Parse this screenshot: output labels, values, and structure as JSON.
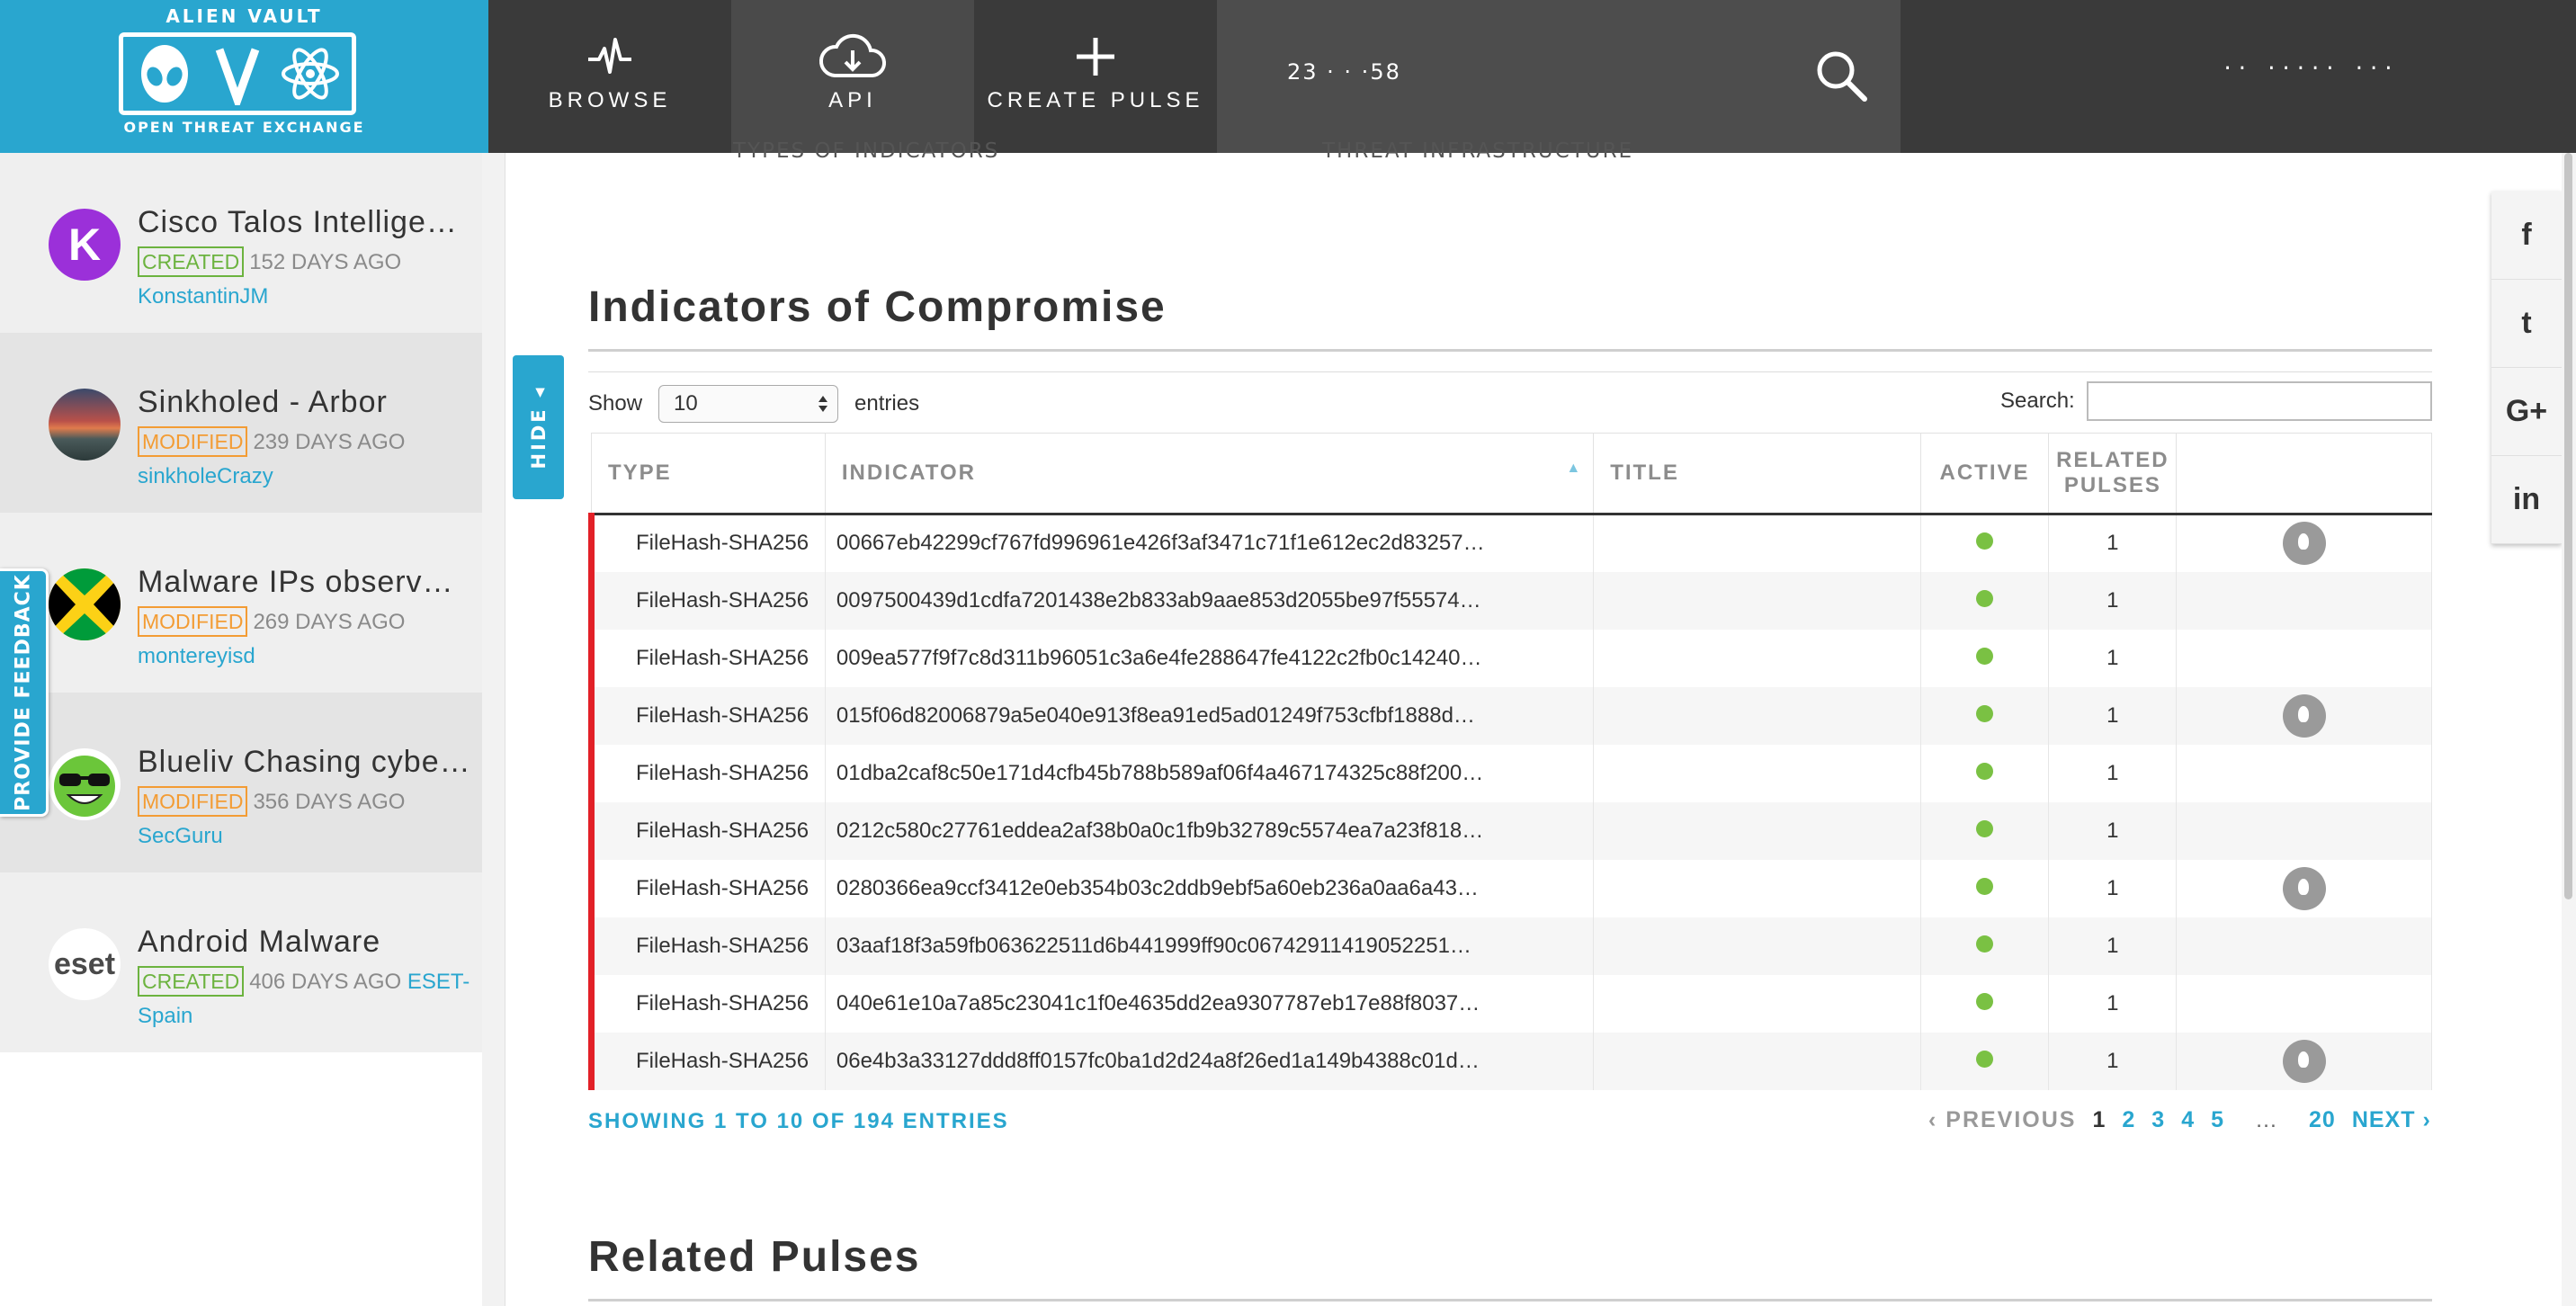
{
  "brand": {
    "top": "ALIEN VAULT",
    "mark": "OTX",
    "bottom": "OPEN THREAT EXCHANGE",
    "color": "#29a6cf"
  },
  "nav": {
    "browse": "BROWSE",
    "api": "API",
    "create": "CREATE PULSE"
  },
  "search": {
    "value": "23 · · ·58"
  },
  "user": {
    "label": "·· ····· ···"
  },
  "hide_tab": "HIDE ◂",
  "feedback": "PROVIDE FEEDBACK",
  "sidebar": {
    "pulses": [
      {
        "title": "Cisco Talos Intelligen…",
        "badge": "CREATED",
        "age": "152 DAYS AGO",
        "author": "KonstantinJM",
        "avatar": "K"
      },
      {
        "title": "Sinkholed - Arbor",
        "badge": "MODIFIED",
        "age": "239 DAYS AGO",
        "author": "sinkholeCrazy"
      },
      {
        "title": "Malware IPs observe…",
        "badge": "MODIFIED",
        "age": "269 DAYS AGO",
        "author": "montereyisd"
      },
      {
        "title": "Blueliv Chasing cyber…",
        "badge": "MODIFIED",
        "age": "356 DAYS AGO",
        "author": "SecGuru"
      },
      {
        "title": "Android Malware",
        "badge": "CREATED",
        "age": "406 DAYS AGO",
        "author_inline": "ESET-",
        "author": "Spain",
        "avatar": "eset"
      }
    ]
  },
  "section_top": {
    "left": "TYPES OF INDICATORS",
    "right": "THREAT INFRASTRUCTURE"
  },
  "ioc": {
    "heading": "Indicators of Compromise",
    "show_label": "Show",
    "show_value": "10",
    "entries_label": "entries",
    "search_label": "Search:",
    "columns": [
      "TYPE",
      "INDICATOR",
      "TITLE",
      "ACTIVE",
      "RELATED",
      "PULSES"
    ],
    "rows": [
      {
        "type": "FileHash-SHA256",
        "indicator": "00667eb42299cf767fd996961e426f3af3471c71f1e612ec2d83257…",
        "related": "1",
        "pulse_btn": true
      },
      {
        "type": "FileHash-SHA256",
        "indicator": "0097500439d1cdfa7201438e2b833ab9aae853d2055be97f55574…",
        "related": "1",
        "pulse_btn": false
      },
      {
        "type": "FileHash-SHA256",
        "indicator": "009ea577f9f7c8d311b96051c3a6e4fe288647fe4122c2fb0c14240…",
        "related": "1",
        "pulse_btn": false
      },
      {
        "type": "FileHash-SHA256",
        "indicator": "015f06d82006879a5e040e913f8ea91ed5ad01249f753cfbf1888d…",
        "related": "1",
        "pulse_btn": true
      },
      {
        "type": "FileHash-SHA256",
        "indicator": "01dba2caf8c50e171d4cfb45b788b589af06f4a467174325c88f200…",
        "related": "1",
        "pulse_btn": false
      },
      {
        "type": "FileHash-SHA256",
        "indicator": "0212c580c27761eddea2af38b0a0c1fb9b32789c5574ea7a23f818…",
        "related": "1",
        "pulse_btn": false
      },
      {
        "type": "FileHash-SHA256",
        "indicator": "0280366ea9ccf3412e0eb354b03c2ddb9ebf5a60eb236a0aa6a43…",
        "related": "1",
        "pulse_btn": true
      },
      {
        "type": "FileHash-SHA256",
        "indicator": "03aaf18f3a59fb063622511d6b441999ff90c06742911419052251…",
        "related": "1",
        "pulse_btn": false
      },
      {
        "type": "FileHash-SHA256",
        "indicator": "040e61e10a7a85c23041c1f0e4635dd2ea9307787eb17e88f8037…",
        "related": "1",
        "pulse_btn": false
      },
      {
        "type": "FileHash-SHA256",
        "indicator": "06e4b3a33127ddd8ff0157fc0ba1d2d24a8f26ed1a149b4388c01d…",
        "related": "1",
        "pulse_btn": true
      }
    ],
    "showing": "SHOWING 1 TO 10 OF 194 ENTRIES",
    "pager": {
      "prev": "‹ PREVIOUS",
      "pages": [
        "1",
        "2",
        "3",
        "4",
        "5"
      ],
      "ellipsis": "…",
      "last": "20",
      "next": "NEXT ›"
    }
  },
  "related": {
    "heading": "Related Pulses"
  },
  "social": [
    "f",
    "t",
    "G+",
    "in"
  ],
  "colors": {
    "active": "#7ac143",
    "created": "#6cb33f",
    "modified": "#f39c34",
    "malicious_bar": "#e22027"
  }
}
